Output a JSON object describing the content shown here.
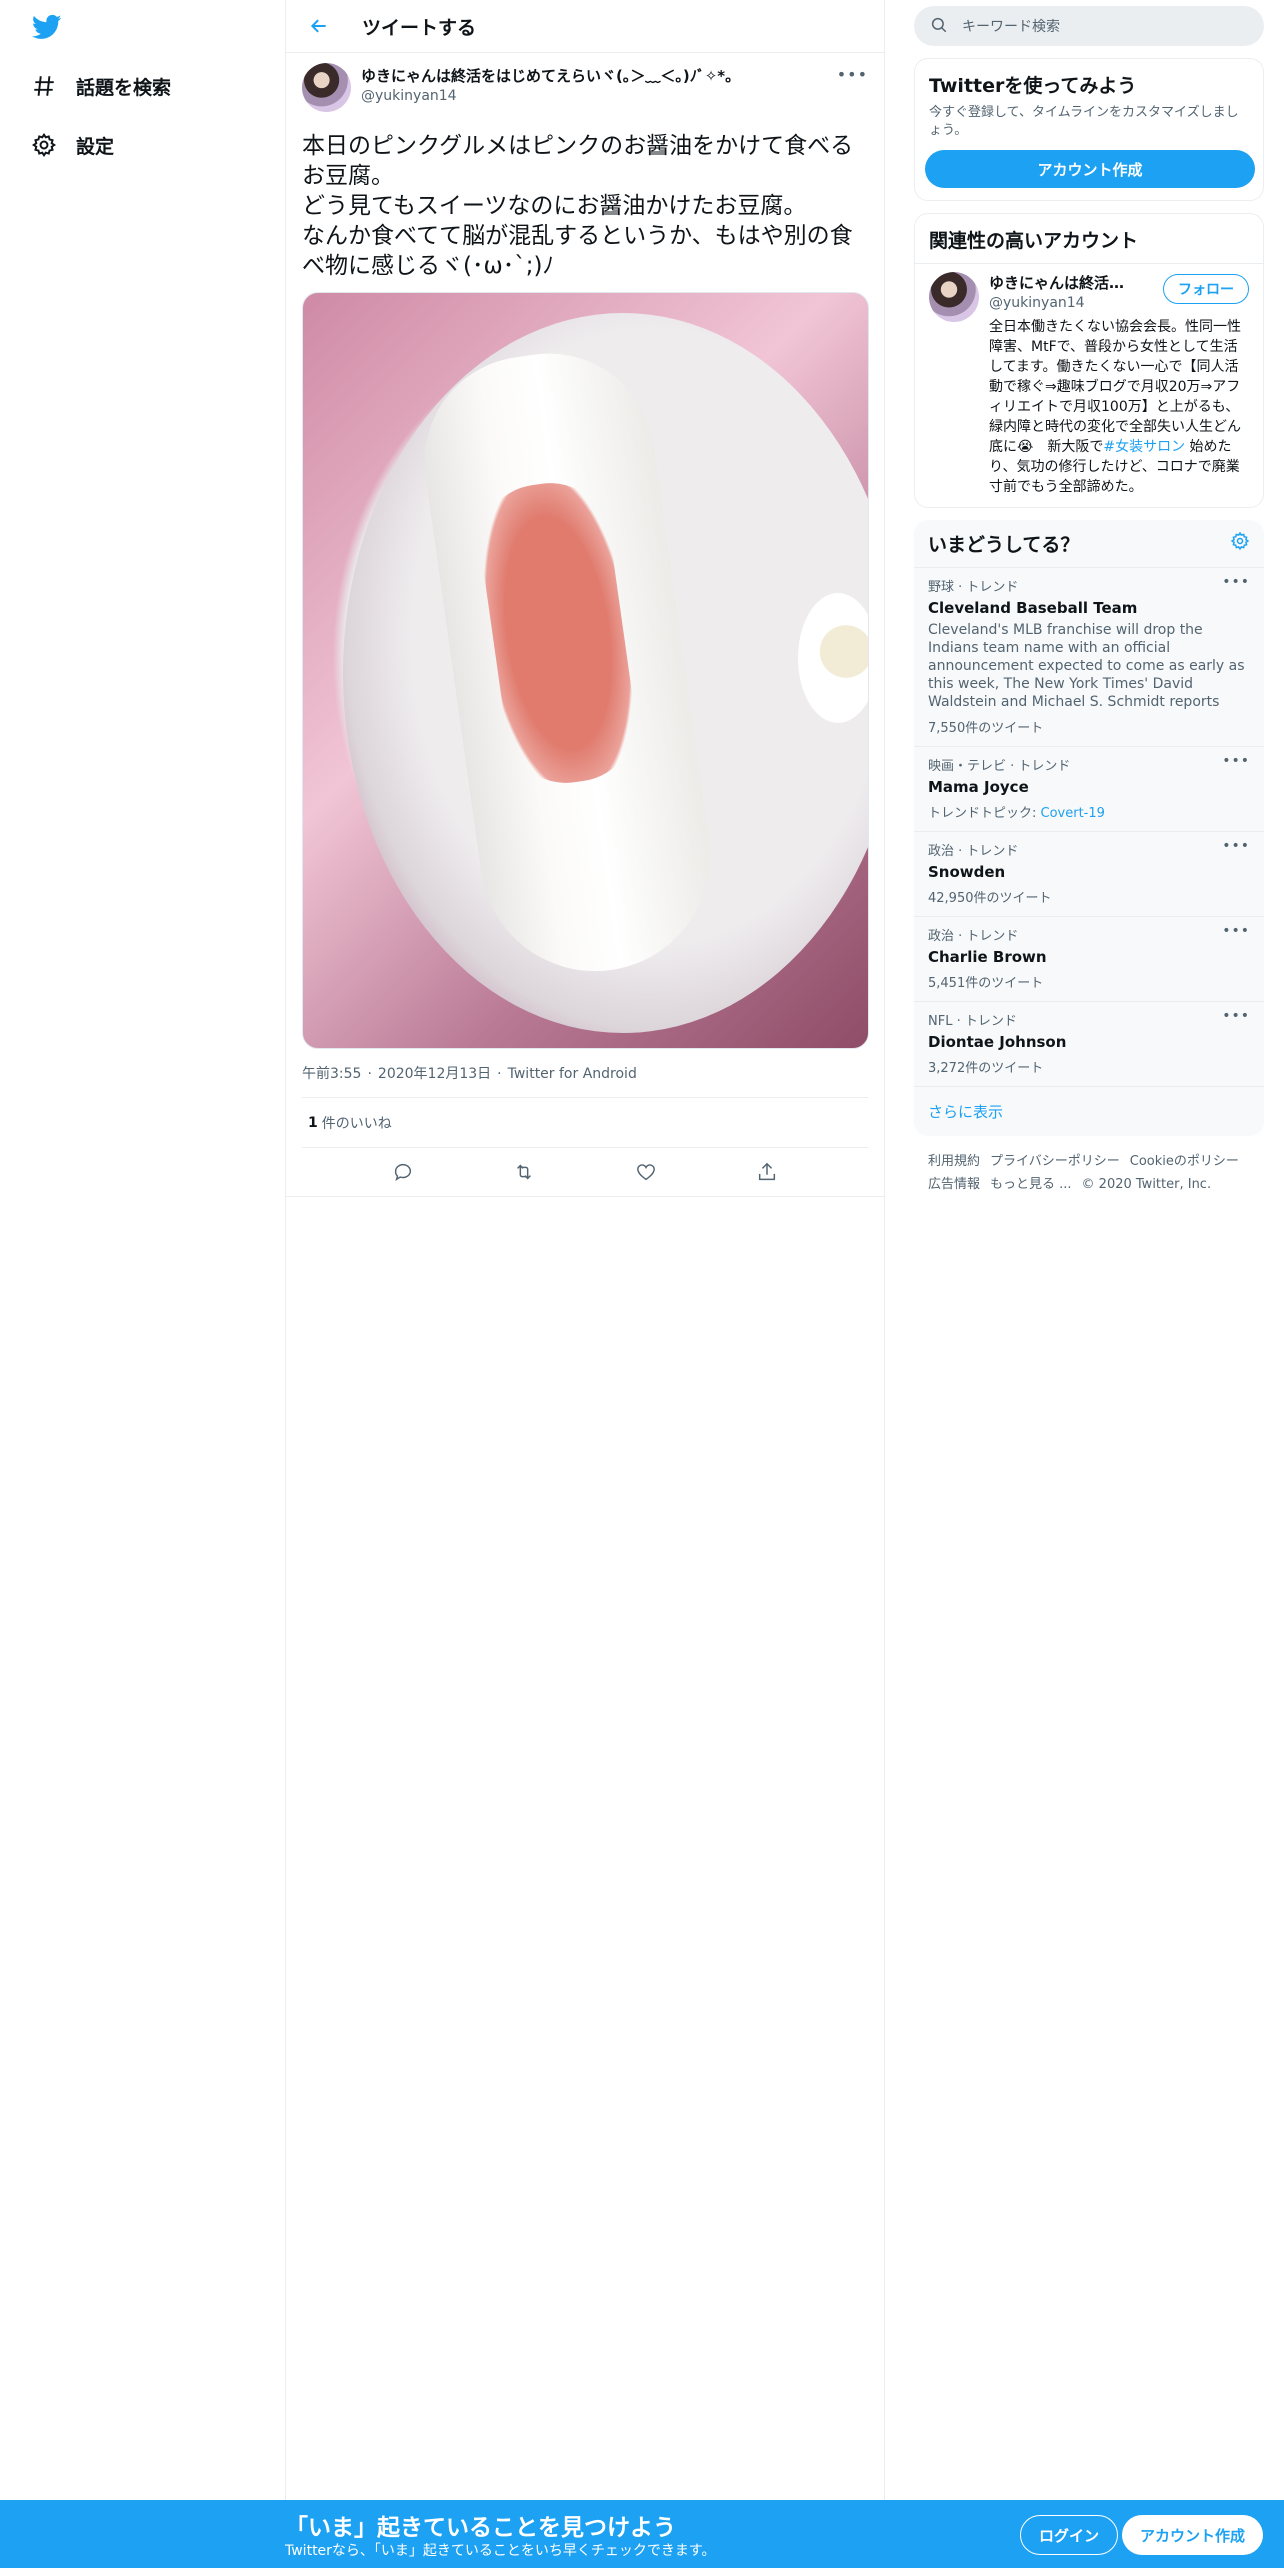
{
  "nav": {
    "explore_label": "話題を検索",
    "settings_label": "設定"
  },
  "header": {
    "title": "ツイートする"
  },
  "tweet": {
    "display_name": "ゆきにゃんは終活をはじめてえらいヾ(｡＞﹏＜｡)ﾉﾞ✧*。",
    "handle": "@yukinyan14",
    "text": "本日のピンクグルメはピンクのお醤油をかけて食べるお豆腐。\nどう見てもスイーツなのにお醤油かけたお豆腐。\nなんか食べてて脳が混乱するというか、もはや別の食べ物に感じるヾ(･ω･`;)ﾉ",
    "time": "午前3:55",
    "date": "2020年12月13日",
    "source": "Twitter for Android",
    "likes_count": "1",
    "likes_label": "件のいいね"
  },
  "search": {
    "placeholder": "キーワード検索"
  },
  "signup_card": {
    "title": "Twitterを使ってみよう",
    "text": "今すぐ登録して、タイムラインをカスタマイズしましょう。",
    "button": "アカウント作成"
  },
  "related": {
    "title": "関連性の高いアカウント",
    "name": "ゆきにゃんは終活を...",
    "handle": "@yukinyan14",
    "follow": "フォロー",
    "bio_before": "全日本働きたくない協会会長。性同一性障害、MtFで、普段から女性として生活してます。働きたくない一心で【同人活動で稼ぐ⇒趣味ブログで月収20万⇒アフィリエイトで月収100万】と上がるも、緑内障と時代の変化で全部失い人生どん底に😭　新大阪で",
    "bio_link": "#女装サロン",
    "bio_after": " 始めたり、気功の修行したけど、コロナで廃業寸前でもう全部諦めた。"
  },
  "trends": {
    "title": "いまどうしてる？",
    "items": [
      {
        "category": "野球 · トレンド",
        "name": "Cleveland Baseball Team",
        "desc": "Cleveland's MLB franchise will drop the Indians team name with an official announcement expected to come as early as this week, The New York Times' David Waldstein and Michael S. Schmidt reports",
        "count": "7,550件のツイート"
      },
      {
        "category": "映画・テレビ · トレンド",
        "name": "Mama Joyce",
        "topic_label": "トレンドトピック: ",
        "topic_link": "Covert-19"
      },
      {
        "category": "政治 · トレンド",
        "name": "Snowden",
        "count": "42,950件のツイート"
      },
      {
        "category": "政治 · トレンド",
        "name": "Charlie Brown",
        "count": "5,451件のツイート"
      },
      {
        "category": "NFL · トレンド",
        "name": "Diontae Johnson",
        "count": "3,272件のツイート"
      }
    ],
    "show_more": "さらに表示"
  },
  "footer": {
    "links": [
      "利用規約",
      "プライバシーポリシー",
      "Cookieのポリシー",
      "広告情報",
      "もっと見る ..."
    ],
    "copyright": "© 2020 Twitter, Inc."
  },
  "bottom_bar": {
    "title": "「いま」起きていることを見つけよう",
    "subtitle": "Twitterなら、「いま」起きていることをいち早くチェックできます。",
    "login": "ログイン",
    "signup": "アカウント作成"
  },
  "colors": {
    "accent": "#1da1f2",
    "text": "#0f1419",
    "muted": "#536471"
  }
}
